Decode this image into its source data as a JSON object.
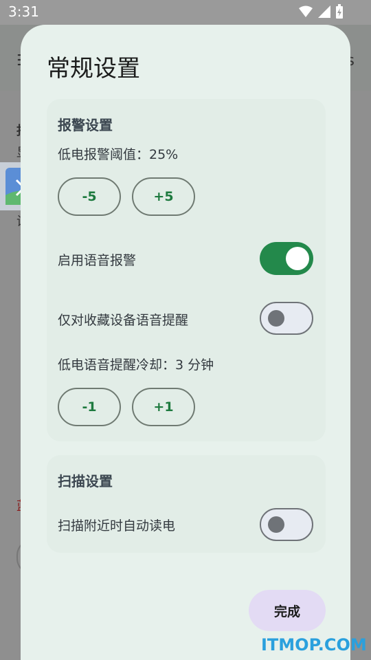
{
  "status_bar": {
    "time": "3:31"
  },
  "background": {
    "menu_icon": "menu-icon",
    "right_text": "s",
    "side_chars": [
      "报",
      "显",
      "设",
      "设"
    ],
    "red_char": "蓝"
  },
  "dialog": {
    "title": "常规设置",
    "alarm_section": {
      "title": "报警设置",
      "threshold_label": "低电报警阈值：25%",
      "minus_label": "-5",
      "plus_label": "+5",
      "voice_alarm_label": "启用语音报警",
      "voice_alarm_on": true,
      "favorites_only_label": "仅对收藏设备语音提醒",
      "favorites_only_on": false,
      "cooldown_label": "低电语音提醒冷却：3  分钟",
      "cooldown_minus_label": "-1",
      "cooldown_plus_label": "+1"
    },
    "scan_section": {
      "title": "扫描设置",
      "auto_read_label": "扫描附近时自动读电",
      "auto_read_on": false
    },
    "done_label": "完成"
  },
  "watermark": "ITMOP.COM",
  "colors": {
    "accent": "#23894b",
    "dialog_bg": "#e7f1ec",
    "done_bg": "#e3dbf4",
    "watermark": "#2aa0dd"
  }
}
